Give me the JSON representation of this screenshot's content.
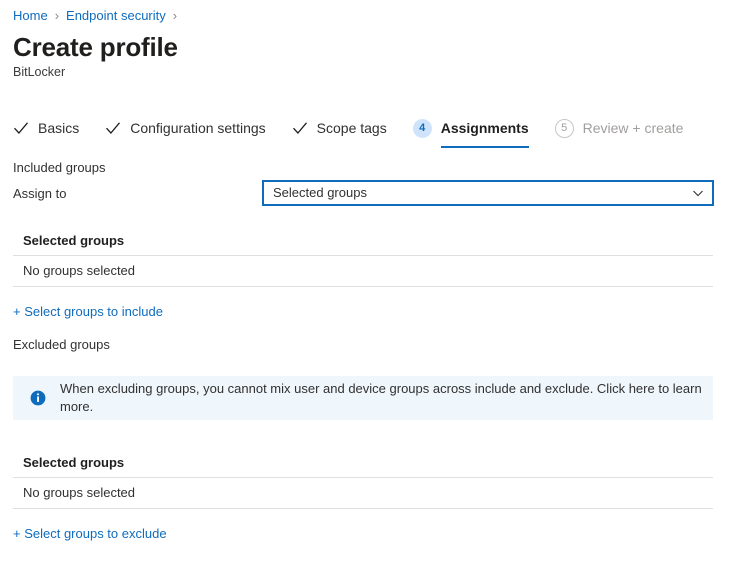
{
  "breadcrumb": {
    "items": [
      {
        "label": "Home"
      },
      {
        "label": "Endpoint security"
      }
    ],
    "separator": "›"
  },
  "header": {
    "title": "Create profile",
    "subtitle": "BitLocker"
  },
  "wizard": {
    "steps": [
      {
        "label": "Basics",
        "state": "complete",
        "marker": "check"
      },
      {
        "label": "Configuration settings",
        "state": "complete",
        "marker": "check"
      },
      {
        "label": "Scope tags",
        "state": "complete",
        "marker": "check"
      },
      {
        "label": "Assignments",
        "state": "current",
        "marker": "4"
      },
      {
        "label": "Review + create",
        "state": "pending",
        "marker": "5"
      }
    ]
  },
  "included": {
    "section_label": "Included groups",
    "assign_to_label": "Assign to",
    "assign_to_value": "Selected groups",
    "assign_to_options": [
      "Selected groups"
    ],
    "grid": {
      "header": "Selected groups",
      "rows": [
        "No groups selected"
      ]
    },
    "add_link": "+ Select groups to include"
  },
  "excluded": {
    "section_label": "Excluded groups",
    "banner": {
      "icon": "info-icon",
      "text": "When excluding groups, you cannot mix user and device groups across include and exclude. Click here to learn more."
    },
    "grid": {
      "header": "Selected groups",
      "rows": [
        "No groups selected"
      ]
    },
    "add_link": "+ Select groups to exclude"
  },
  "colors": {
    "link": "#0f6cbd",
    "accent": "#0f6cbd",
    "info_bg": "#eff6fc",
    "border": "#e1dfdd",
    "text": "#323130"
  }
}
